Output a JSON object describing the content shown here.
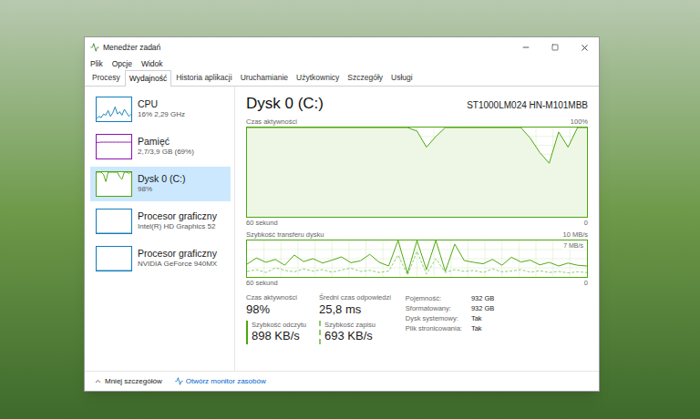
{
  "window": {
    "title": "Menedżer zadań"
  },
  "menu": [
    "Plik",
    "Opcje",
    "Widok"
  ],
  "tabs": [
    {
      "label": "Procesy",
      "selected": false
    },
    {
      "label": "Wydajność",
      "selected": true
    },
    {
      "label": "Historia aplikacji",
      "selected": false
    },
    {
      "label": "Uruchamianie",
      "selected": false
    },
    {
      "label": "Użytkownicy",
      "selected": false
    },
    {
      "label": "Szczegóły",
      "selected": false
    },
    {
      "label": "Usługi",
      "selected": false
    }
  ],
  "sidebar": {
    "items": [
      {
        "name": "CPU",
        "detail": "16% 2,29 GHz",
        "selected": false,
        "color": "#117dbb",
        "graph": [
          10,
          20,
          15,
          30,
          25,
          45,
          20,
          35,
          60,
          30,
          40,
          25,
          50,
          35,
          20,
          30
        ]
      },
      {
        "name": "Pamięć",
        "detail": "2,7/3,9 GB (69%)",
        "selected": false,
        "color": "#8b12ae",
        "graph": [
          68,
          68,
          69,
          69,
          69,
          69,
          69,
          69,
          69,
          69,
          69,
          69,
          69,
          69,
          69,
          69
        ]
      },
      {
        "name": "Dysk 0 (C:)",
        "detail": "98%",
        "selected": true,
        "color": "#4da60c",
        "graph": [
          100,
          100,
          100,
          90,
          60,
          100,
          100,
          100,
          100,
          100,
          80,
          70,
          100,
          100,
          95,
          100
        ]
      },
      {
        "name": "Procesor graficzny",
        "detail": "Intel(R) HD Graphics 52",
        "selected": false,
        "color": "#117dbb",
        "graph": [
          0,
          0,
          0,
          0,
          0,
          0,
          0,
          0,
          0,
          0,
          0,
          0,
          0,
          0,
          0,
          0
        ]
      },
      {
        "name": "Procesor graficzny",
        "detail": "NVIDIA GeForce 940MX",
        "selected": false,
        "color": "#117dbb",
        "graph": [
          0,
          0,
          0,
          0,
          0,
          0,
          0,
          0,
          0,
          0,
          0,
          0,
          0,
          0,
          0,
          0
        ]
      }
    ]
  },
  "panel": {
    "title": "Dysk 0 (C:)",
    "model": "ST1000LM024 HN-M101MBB",
    "activity_chart": {
      "title": "Czas aktywności",
      "max_label": "100%",
      "x_label": "60 sekund",
      "x_end": "0",
      "max": 100,
      "values": [
        100,
        100,
        100,
        100,
        100,
        100,
        100,
        100,
        100,
        100,
        100,
        100,
        100,
        100,
        100,
        100,
        100,
        100,
        96,
        78,
        90,
        100,
        100,
        100,
        100,
        100,
        100,
        100,
        100,
        100,
        88,
        72,
        60,
        95,
        78,
        100,
        100
      ]
    },
    "transfer_chart": {
      "title": "Szybkość transferu dysku",
      "max_label": "10 MB/s",
      "mark_label": "7 MB/s",
      "x_label": "60 sekund",
      "x_end": "0",
      "max": 10,
      "read": [
        3.5,
        5.2,
        4.0,
        4.8,
        3.2,
        6.0,
        4.2,
        5.0,
        3.8,
        4.6,
        5.5,
        3.9,
        4.4,
        6.2,
        4.0,
        3.0,
        10,
        1,
        10,
        2,
        10,
        1.5,
        9,
        4.5,
        4.0,
        3.6,
        4.8,
        3.2,
        5.4,
        4.1,
        4.6,
        3.3,
        4.0,
        3.0,
        3.8,
        3.2,
        3.0
      ],
      "write": [
        1.5,
        2.0,
        1.2,
        2.5,
        1.8,
        1.4,
        2.2,
        1.6,
        2.0,
        1.3,
        1.9,
        2.4,
        1.5,
        1.8,
        1.2,
        1.6,
        6,
        0.5,
        7,
        0.8,
        5,
        1.2,
        2.0,
        1.5,
        1.8,
        1.2,
        2.2,
        1.4,
        1.6,
        2.0,
        1.3,
        1.7,
        1.2,
        1.5,
        1.1,
        1.4,
        1.2
      ]
    },
    "stats": [
      {
        "label": "Czas aktywności",
        "value": "98%",
        "kind": "plain"
      },
      {
        "label": "Średni czas odpowiedzi",
        "value": "25,8 ms",
        "kind": "plain"
      },
      {
        "label": "Szybkość odczytu",
        "value": "898 KB/s",
        "kind": "read"
      },
      {
        "label": "Szybkość zapisu",
        "value": "693 KB/s",
        "kind": "write"
      }
    ],
    "properties": [
      {
        "label": "Pojemność:",
        "value": "932 GB"
      },
      {
        "label": "Sformatowany:",
        "value": "932 GB"
      },
      {
        "label": "Dysk systemowy:",
        "value": "Tak"
      },
      {
        "label": "Plik stronicowania:",
        "value": "Tak"
      }
    ]
  },
  "footer": {
    "less": "Mniej szczegółów",
    "monitor": "Otwórz monitor zasobów"
  }
}
